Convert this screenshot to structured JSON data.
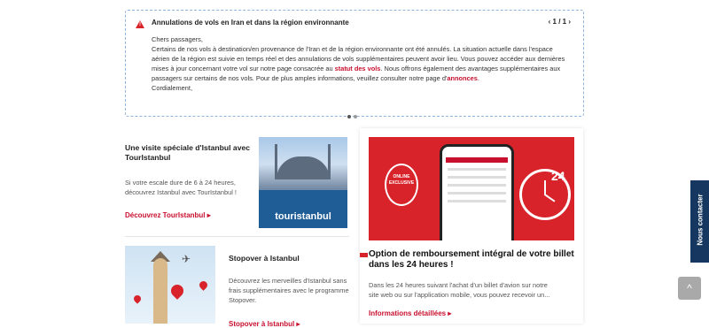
{
  "notice": {
    "title": "Annulations de vols en Iran et dans la région environnante",
    "pager": "‹ 1 / 1 ›",
    "greeting": "Chers passagers,",
    "text1": "Certains de nos vols à destination/en provenance de l'Iran et de la région environnante ont été annulés. La situation actuelle dans l'espace aérien de la région est suivie en temps réel et des annulations de vols supplémentaires peuvent avoir lieu. Vous pouvez accéder aux dernières mises à jour concernant votre vol sur notre page consacrée au ",
    "link1": "statut des vols",
    "text2": ". Nous offrons également des avantages supplémentaires aux passagers sur certains de nos vols. Pour de plus amples informations, veuillez consulter notre page d'",
    "link2": "annonces",
    "text3": ".",
    "closing": "Cordialement,"
  },
  "cards": {
    "touristanbul": {
      "title": "Une visite spéciale d'Istanbul avec TourIstanbul",
      "desc": "Si votre escale dure de 6 à 24 heures, découvrez Istanbul avec TourIstanbul !",
      "link": "Découvrez TourIstanbul ▸",
      "brand": "touristanbul"
    },
    "stopover": {
      "title": "Stopover à Istanbul",
      "desc": "Découvrez les merveilles d'Istanbul sans frais supplémentaires avec le programme Stopover.",
      "link": "Stopover à Istanbul ▸"
    },
    "refund": {
      "title": "Option de remboursement intégral de votre billet dans les 24 heures !",
      "desc": "Dans les 24 heures suivant l'achat d'un billet d'avion sur notre site web ou sur l'application mobile, vous pouvez recevoir un...",
      "link": "Informations détaillées ▸",
      "badge": "ONLINE EXCLUSIVE",
      "hours": "24"
    }
  },
  "contact": {
    "label": "Nous contacter"
  },
  "totop": {
    "label": "^"
  }
}
